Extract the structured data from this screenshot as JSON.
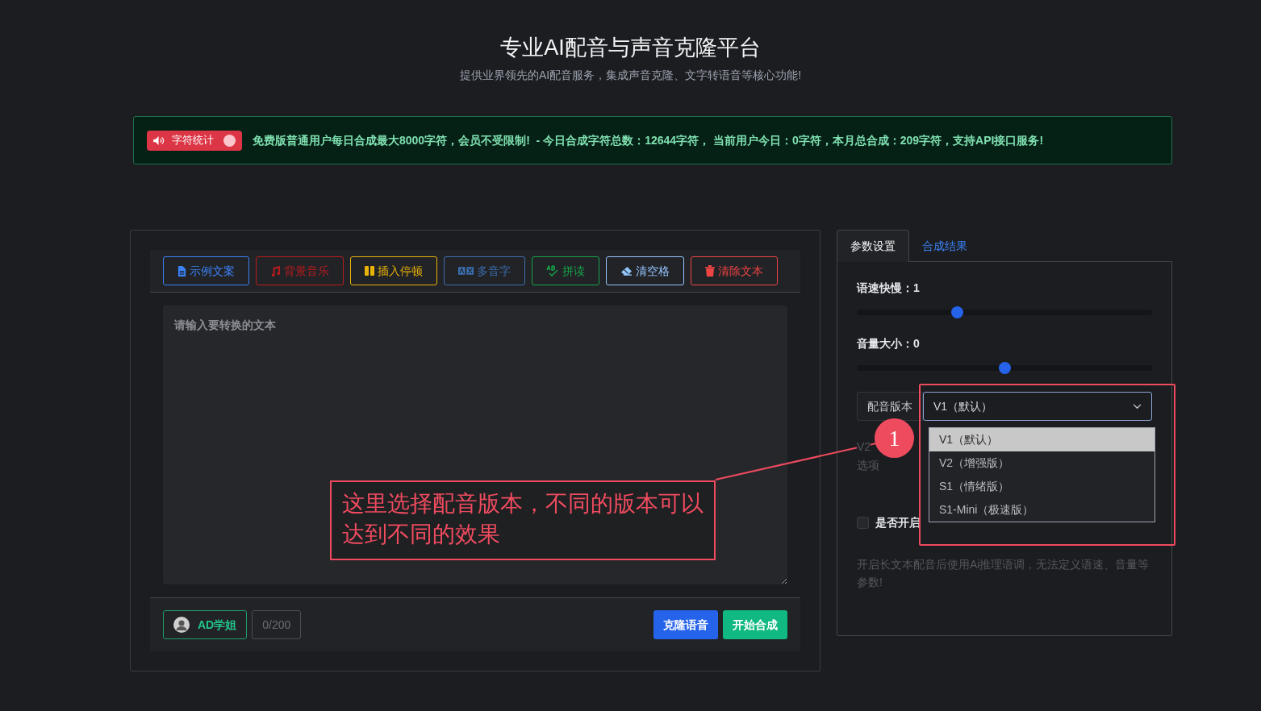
{
  "header": {
    "title": "专业AI配音与声音克隆平台",
    "subtitle": "提供业界领先的AI配音服务，集成声音克隆、文字转语音等核心功能!"
  },
  "notice": {
    "badge": "字符统计",
    "badge_dot": true,
    "message": "免费版普通用户每日合成最大8000字符，会员不受限制!  - 今日合成字符总数：12644字符， 当前用户今日：0字符，本月总合成：209字符，支持API接口服务!"
  },
  "toolbar": [
    {
      "label": "示例文案",
      "kind": "file",
      "color": "#3b82f6"
    },
    {
      "label": "背景音乐",
      "kind": "music",
      "color": "#b91c1c"
    },
    {
      "label": "插入停顿",
      "kind": "pause",
      "color": "#eab308"
    },
    {
      "label": "多音字",
      "kind": "ab",
      "color": "#3b6fb0"
    },
    {
      "label": "拼读",
      "kind": "spell",
      "color": "#16a34a"
    },
    {
      "label": "清空格",
      "kind": "eraser",
      "color": "#93c5fd"
    },
    {
      "label": "清除文本",
      "kind": "trash",
      "color": "#ef4444"
    }
  ],
  "editor": {
    "placeholder": "请输入要转换的文本"
  },
  "footer": {
    "voice": "AD学姐",
    "counter": "0/200",
    "buttons": [
      {
        "label": "克隆语音",
        "kind": "primary"
      },
      {
        "label": "开始合成",
        "kind": "success"
      }
    ]
  },
  "tabs": [
    {
      "label": "参数设置",
      "selected": true
    },
    {
      "label": "合成结果",
      "selected": false
    }
  ],
  "sliders": [
    {
      "label": "语速快慢：1",
      "level": 0.34
    },
    {
      "label": "音量大小：0",
      "level": 0.5
    }
  ],
  "version": {
    "label": "配音版本",
    "value": "V1（默认）",
    "hint_1": "V2",
    "hint_2": "选项",
    "options": [
      {
        "label": "V1（默认）",
        "selected": true
      },
      {
        "label": "V2（增强版）",
        "selected": false
      },
      {
        "label": "S1（情绪版）",
        "selected": false
      },
      {
        "label": "S1-Mini（极速版）",
        "selected": false
      }
    ]
  },
  "long_text": {
    "label": "是否开启",
    "checked": false,
    "note": "开启长文本配音后使用Ai推理语调，无法定义语速、音量等参数!"
  },
  "annotation": {
    "number": "1",
    "text": "这里选择配音版本，不同的版本可以达到不同的效果"
  }
}
